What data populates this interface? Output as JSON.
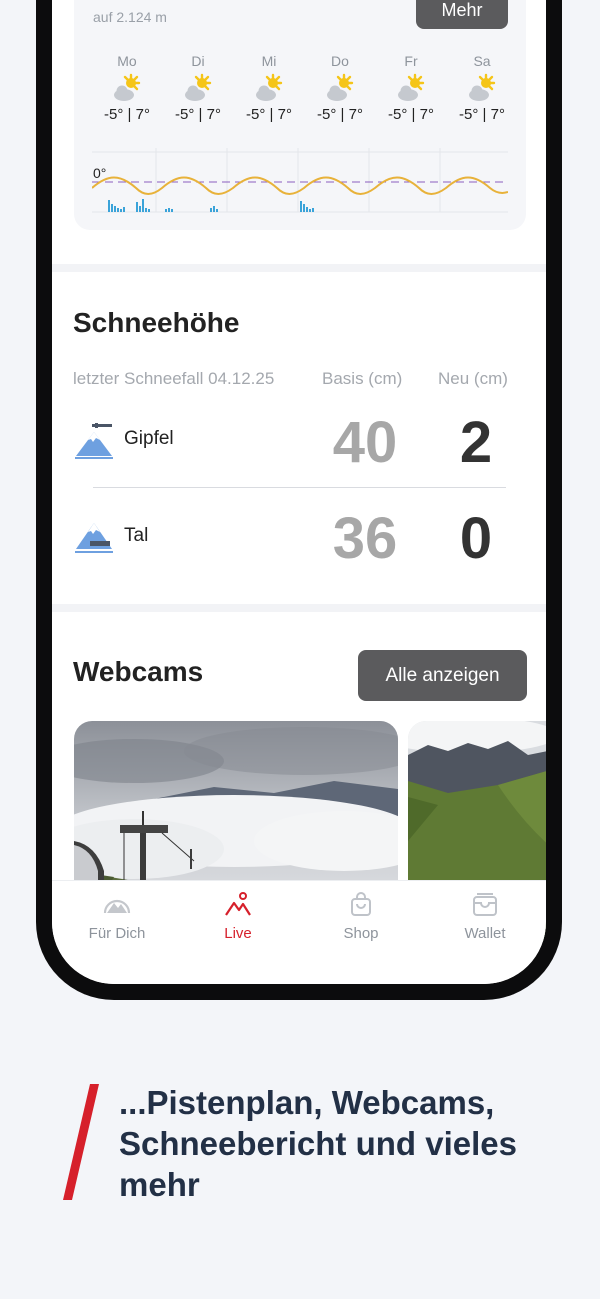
{
  "weather": {
    "altitude": "auf 2.124 m",
    "more_label": "Mehr",
    "zero_label": "0°",
    "days": [
      {
        "name": "Mo",
        "temps": "-5° | 7°",
        "icon": "partly-sunny-icon"
      },
      {
        "name": "Di",
        "temps": "-5° | 7°",
        "icon": "partly-sunny-icon"
      },
      {
        "name": "Mi",
        "temps": "-5° | 7°",
        "icon": "partly-sunny-icon"
      },
      {
        "name": "Do",
        "temps": "-5° | 7°",
        "icon": "partly-sunny-icon"
      },
      {
        "name": "Fr",
        "temps": "-5° | 7°",
        "icon": "partly-sunny-icon"
      },
      {
        "name": "Sa",
        "temps": "-5° | 7°",
        "icon": "partly-sunny-icon"
      }
    ]
  },
  "snow": {
    "title": "Schneehöhe",
    "last_snowfall": "letzter Schneefall 04.12.25",
    "col_base": "Basis (cm)",
    "col_new": "Neu (cm)",
    "rows": [
      {
        "label": "Gipfel",
        "base": "40",
        "new": "2",
        "icon": "mountain-peak-icon"
      },
      {
        "label": "Tal",
        "base": "36",
        "new": "0",
        "icon": "mountain-valley-icon"
      }
    ]
  },
  "webcams": {
    "title": "Webcams",
    "all_label": "Alle anzeigen"
  },
  "tabs": [
    {
      "label": "Für Dich",
      "icon": "mountain-arc-icon",
      "active": false
    },
    {
      "label": "Live",
      "icon": "mountain-pin-icon",
      "active": true
    },
    {
      "label": "Shop",
      "icon": "shopping-bag-icon",
      "active": false
    },
    {
      "label": "Wallet",
      "icon": "wallet-icon",
      "active": false
    }
  ],
  "tagline": "...Pistenplan, Webcams, Schneebericht und vieles mehr",
  "colors": {
    "accent": "#d6202b",
    "button": "#5b5b5d",
    "sun": "#f5c518",
    "temperature_curve": "#e8b23a",
    "precipitation": "#3aa3d9",
    "zero_line": "#8a5fbf"
  }
}
